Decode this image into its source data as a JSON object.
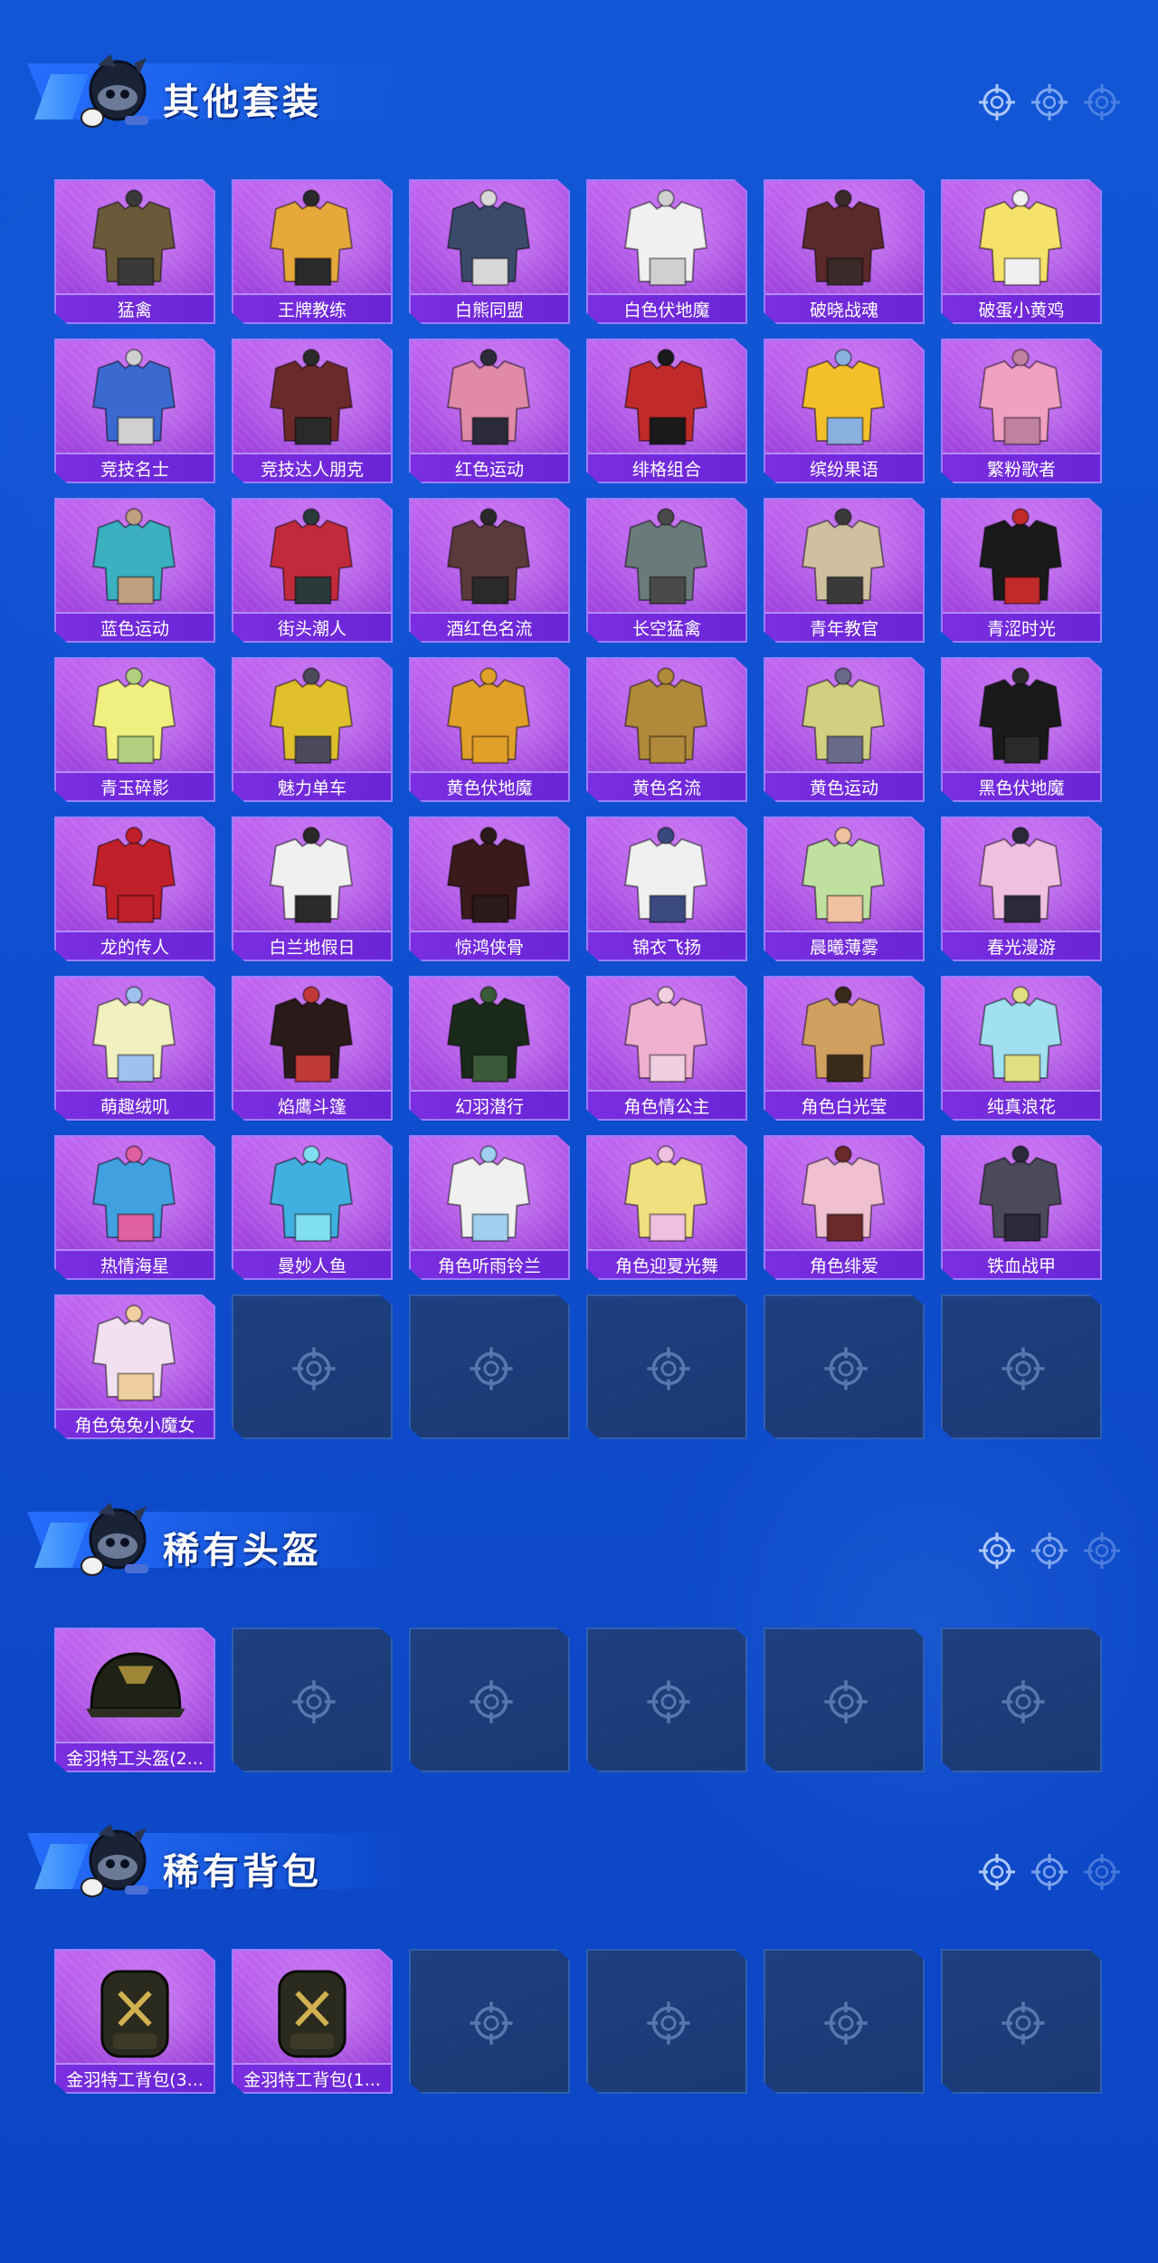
{
  "sections": [
    {
      "title": "其他套装",
      "items": [
        "猛禽",
        "王牌教练",
        "白熊同盟",
        "白色伏地魔",
        "破晓战魂",
        "破蛋小黄鸡",
        "竞技名士",
        "竞技达人朋克",
        "红色运动",
        "绯格组合",
        "缤纷果语",
        "繁粉歌者",
        "蓝色运动",
        "街头潮人",
        "酒红色名流",
        "长空猛禽",
        "青年教官",
        "青涩时光",
        "青玉碎影",
        "魅力单车",
        "黄色伏地魔",
        "黄色名流",
        "黄色运动",
        "黑色伏地魔",
        "龙的传人",
        "白兰地假日",
        "惊鸿侠骨",
        "锦衣飞扬",
        "晨曦薄雾",
        "春光漫游",
        "萌趣绒叽",
        "焰鹰斗篷",
        "幻羽潜行",
        "角色情公主",
        "角色白光莹",
        "纯真浪花",
        "热情海星",
        "曼妙人鱼",
        "角色听雨铃兰",
        "角色迎夏光舞",
        "角色绯爱",
        "铁血战甲",
        "角色兔兔小魔女"
      ],
      "empty_slots": 5
    },
    {
      "title": "稀有头盔",
      "items": [
        "金羽特工头盔(2..."
      ],
      "empty_slots": 5
    },
    {
      "title": "稀有背包",
      "items": [
        "金羽特工背包(3...",
        "金羽特工背包(1..."
      ],
      "empty_slots": 4
    }
  ],
  "icons": {
    "section_deco": "crosshair-icon",
    "empty_slot": "crosshair-icon",
    "mascot": "mascot-icon"
  },
  "colors": {
    "background": "#1257d6",
    "tile_filled": "#a246e0",
    "tile_label": "#7a2ee0",
    "tile_empty": "#1e3f80"
  }
}
